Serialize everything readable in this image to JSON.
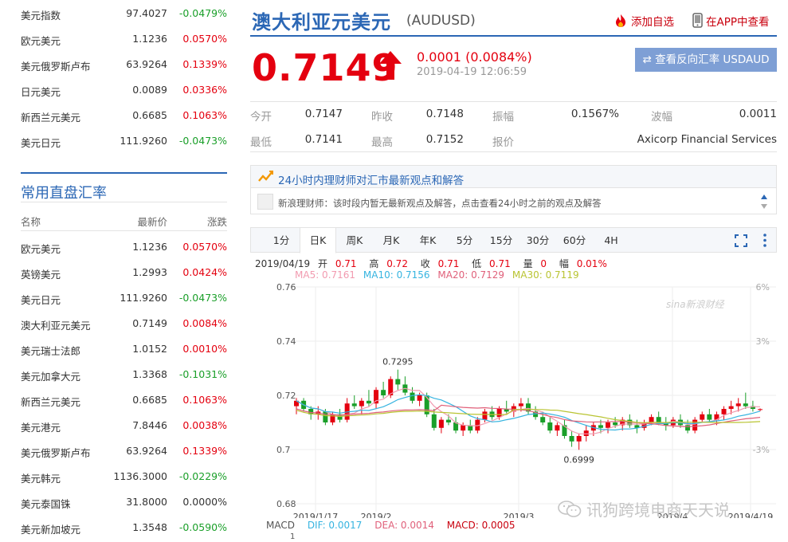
{
  "top_quotes": [
    {
      "name": "美元指数",
      "price": "97.4027",
      "change": "-0.0479%",
      "dir": "down"
    },
    {
      "name": "欧元美元",
      "price": "1.1236",
      "change": "0.0570%",
      "dir": "up"
    },
    {
      "name": "美元俄罗斯卢布",
      "price": "63.9264",
      "change": "0.1339%",
      "dir": "up"
    },
    {
      "name": "日元美元",
      "price": "0.0089",
      "change": "0.0336%",
      "dir": "up"
    },
    {
      "name": "新西兰元美元",
      "price": "0.6685",
      "change": "0.1063%",
      "dir": "up"
    },
    {
      "name": "美元日元",
      "price": "111.9260",
      "change": "-0.0473%",
      "dir": "down"
    }
  ],
  "common": {
    "title": "常用直盘汇率",
    "col_name": "名称",
    "col_price": "最新价",
    "col_change": "涨跌",
    "rows": [
      {
        "name": "欧元美元",
        "price": "1.1236",
        "change": "0.0570%",
        "dir": "up"
      },
      {
        "name": "英镑美元",
        "price": "1.2993",
        "change": "0.0424%",
        "dir": "up"
      },
      {
        "name": "美元日元",
        "price": "111.9260",
        "change": "-0.0473%",
        "dir": "down"
      },
      {
        "name": "澳大利亚元美元",
        "price": "0.7149",
        "change": "0.0084%",
        "dir": "up"
      },
      {
        "name": "美元瑞士法郎",
        "price": "1.0152",
        "change": "0.0010%",
        "dir": "up"
      },
      {
        "name": "美元加拿大元",
        "price": "1.3368",
        "change": "-0.1031%",
        "dir": "down"
      },
      {
        "name": "新西兰元美元",
        "price": "0.6685",
        "change": "0.1063%",
        "dir": "up"
      },
      {
        "name": "美元港元",
        "price": "7.8446",
        "change": "0.0038%",
        "dir": "up"
      },
      {
        "name": "美元俄罗斯卢布",
        "price": "63.9264",
        "change": "0.1339%",
        "dir": "up"
      },
      {
        "name": "美元韩元",
        "price": "1136.3000",
        "change": "-0.0229%",
        "dir": "down"
      },
      {
        "name": "美元泰国铢",
        "price": "31.8000",
        "change": "0.0000%",
        "dir": "neutral"
      },
      {
        "name": "美元新加坡元",
        "price": "1.3548",
        "change": "-0.0590%",
        "dir": "down"
      }
    ]
  },
  "header": {
    "title": "澳大利亚元美元",
    "code": "(AUDUSD)",
    "add_watch": "添加自选",
    "view_app": "在APP中查看"
  },
  "price": {
    "last": "0.7149",
    "change": "0.0001 (0.0084%)",
    "time": "2019-04-19 12:06:59",
    "reverse_btn": "⇄ 查看反向汇率 USDAUD"
  },
  "stats": {
    "open_label": "今开",
    "open": "0.7147",
    "prev_label": "昨收",
    "prev": "0.7148",
    "amp_label": "振幅",
    "amp": "0.1567%",
    "spread_label": "波幅",
    "spread": "0.0011",
    "low_label": "最低",
    "low": "0.7141",
    "high_label": "最高",
    "high": "0.7152",
    "quote_label": "报价",
    "quote": "Axicorp Financial Services"
  },
  "opinion": {
    "title": "24小时内理财师对汇市最新观点和解答",
    "line": "新浪理财师：该时段内暂无最新观点及解答，点击查看24小时之前的观点及解答"
  },
  "tabs": [
    "1分",
    "日K",
    "周K",
    "月K",
    "年K",
    "5分",
    "15分",
    "30分",
    "60分",
    "4H"
  ],
  "active_tab": 1,
  "kinfo": {
    "date": "2019/04/19",
    "open_l": "开",
    "open": "0.71",
    "high_l": "高",
    "high": "0.72",
    "close_l": "收",
    "close": "0.71",
    "low_l": "低",
    "low": "0.71",
    "vol_l": "量",
    "vol": "0",
    "amp_l": "幅",
    "amp": "0.01%",
    "ma5": "MA5: 0.7161",
    "ma10": "MA10: 0.7156",
    "ma20": "MA20: 0.7129",
    "ma30": "MA30: 0.7119"
  },
  "macd": {
    "label": "MACD",
    "dif": "DIF: 0.0017",
    "dea": "DEA: 0.0014",
    "macd": "MACD: 0.0005",
    "axis_top": "1"
  },
  "chart_data": {
    "type": "line",
    "title": "",
    "ylim": [
      0.68,
      0.76
    ],
    "yticks": [
      "0.76",
      "0.74",
      "0.72",
      "0.7",
      "0.68"
    ],
    "pct_ticks": [
      "6%",
      "3%",
      "-3%"
    ],
    "xticks": [
      "2019/1/17",
      "2019/2",
      "2019/3",
      "2019/4",
      "2019/4/19"
    ],
    "annotations": [
      {
        "text": "0.7295",
        "value": 0.7295
      },
      {
        "text": "0.6999",
        "value": 0.6999
      }
    ],
    "watermark_logo": "sina新浪财经",
    "candles": [
      [
        0.716,
        0.719,
        0.713,
        0.718
      ],
      [
        0.718,
        0.719,
        0.714,
        0.715
      ],
      [
        0.715,
        0.716,
        0.711,
        0.713
      ],
      [
        0.713,
        0.716,
        0.711,
        0.714
      ],
      [
        0.714,
        0.715,
        0.709,
        0.71
      ],
      [
        0.71,
        0.714,
        0.709,
        0.713
      ],
      [
        0.713,
        0.715,
        0.71,
        0.711
      ],
      [
        0.711,
        0.719,
        0.71,
        0.717
      ],
      [
        0.717,
        0.72,
        0.715,
        0.716
      ],
      [
        0.716,
        0.719,
        0.713,
        0.718
      ],
      [
        0.718,
        0.722,
        0.716,
        0.717
      ],
      [
        0.717,
        0.723,
        0.715,
        0.722
      ],
      [
        0.722,
        0.725,
        0.719,
        0.72
      ],
      [
        0.72,
        0.727,
        0.719,
        0.726
      ],
      [
        0.726,
        0.7295,
        0.722,
        0.724
      ],
      [
        0.724,
        0.727,
        0.72,
        0.721
      ],
      [
        0.721,
        0.723,
        0.717,
        0.718
      ],
      [
        0.718,
        0.721,
        0.716,
        0.72
      ],
      [
        0.72,
        0.721,
        0.712,
        0.713
      ],
      [
        0.713,
        0.715,
        0.707,
        0.708
      ],
      [
        0.708,
        0.712,
        0.706,
        0.711
      ],
      [
        0.711,
        0.713,
        0.709,
        0.71
      ],
      [
        0.71,
        0.712,
        0.706,
        0.707
      ],
      [
        0.707,
        0.71,
        0.705,
        0.709
      ],
      [
        0.709,
        0.711,
        0.706,
        0.707
      ],
      [
        0.707,
        0.712,
        0.706,
        0.711
      ],
      [
        0.711,
        0.715,
        0.71,
        0.714
      ],
      [
        0.714,
        0.716,
        0.711,
        0.712
      ],
      [
        0.712,
        0.716,
        0.711,
        0.715
      ],
      [
        0.715,
        0.718,
        0.713,
        0.714
      ],
      [
        0.714,
        0.717,
        0.712,
        0.716
      ],
      [
        0.716,
        0.719,
        0.714,
        0.717
      ],
      [
        0.717,
        0.719,
        0.713,
        0.714
      ],
      [
        0.714,
        0.716,
        0.711,
        0.712
      ],
      [
        0.712,
        0.714,
        0.709,
        0.71
      ],
      [
        0.71,
        0.712,
        0.706,
        0.707
      ],
      [
        0.707,
        0.71,
        0.705,
        0.709
      ],
      [
        0.709,
        0.711,
        0.704,
        0.705
      ],
      [
        0.705,
        0.707,
        0.701,
        0.703
      ],
      [
        0.703,
        0.706,
        0.6999,
        0.705
      ],
      [
        0.705,
        0.709,
        0.703,
        0.707
      ],
      [
        0.707,
        0.71,
        0.705,
        0.709
      ],
      [
        0.709,
        0.711,
        0.706,
        0.708
      ],
      [
        0.708,
        0.711,
        0.706,
        0.71
      ],
      [
        0.71,
        0.712,
        0.708,
        0.709
      ],
      [
        0.709,
        0.712,
        0.707,
        0.711
      ],
      [
        0.711,
        0.713,
        0.708,
        0.709
      ],
      [
        0.709,
        0.711,
        0.706,
        0.708
      ],
      [
        0.708,
        0.711,
        0.707,
        0.71
      ],
      [
        0.71,
        0.713,
        0.709,
        0.712
      ],
      [
        0.712,
        0.714,
        0.709,
        0.71
      ],
      [
        0.71,
        0.712,
        0.707,
        0.709
      ],
      [
        0.709,
        0.712,
        0.708,
        0.711
      ],
      [
        0.711,
        0.713,
        0.708,
        0.709
      ],
      [
        0.709,
        0.711,
        0.706,
        0.707
      ],
      [
        0.707,
        0.712,
        0.706,
        0.711
      ],
      [
        0.711,
        0.714,
        0.71,
        0.713
      ],
      [
        0.713,
        0.715,
        0.71,
        0.711
      ],
      [
        0.711,
        0.714,
        0.709,
        0.713
      ],
      [
        0.713,
        0.716,
        0.711,
        0.715
      ],
      [
        0.715,
        0.718,
        0.713,
        0.716
      ],
      [
        0.716,
        0.719,
        0.714,
        0.717
      ],
      [
        0.717,
        0.721,
        0.715,
        0.716
      ],
      [
        0.716,
        0.718,
        0.714,
        0.715
      ],
      [
        0.7147,
        0.7152,
        0.7141,
        0.7149
      ]
    ],
    "series": [
      {
        "name": "MA5",
        "color": "#f29bb0"
      },
      {
        "name": "MA10",
        "color": "#36b4e0"
      },
      {
        "name": "MA20",
        "color": "#e0607a"
      },
      {
        "name": "MA30",
        "color": "#b9c432"
      }
    ]
  },
  "watermark": "讯狗跨境电商天天说",
  "colors": {
    "brand": "#2b67b5",
    "up": "#e4000f",
    "down": "#1a9f29",
    "button": "#7e9fd5"
  }
}
